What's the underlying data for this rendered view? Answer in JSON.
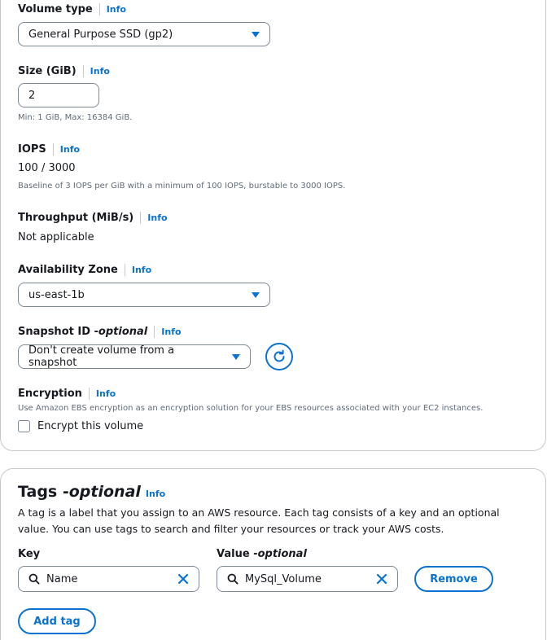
{
  "volume_type": {
    "label": "Volume type",
    "info": "Info",
    "selected": "General Purpose SSD (gp2)"
  },
  "size": {
    "label": "Size (GiB)",
    "info": "Info",
    "value": "2",
    "hint": "Min: 1 GiB, Max: 16384 GiB."
  },
  "iops": {
    "label": "IOPS",
    "info": "Info",
    "value": "100 / 3000",
    "hint": "Baseline of 3 IOPS per GiB with a minimum of 100 IOPS, burstable to 3000 IOPS."
  },
  "throughput": {
    "label": "Throughput (MiB/s)",
    "info": "Info",
    "value": "Not applicable"
  },
  "availability_zone": {
    "label": "Availability Zone",
    "info": "Info",
    "selected": "us-east-1b"
  },
  "snapshot": {
    "label": "Snapshot ID - ",
    "optional": "optional",
    "info": "Info",
    "selected": "Don't create volume from a snapshot"
  },
  "encryption": {
    "label": "Encryption",
    "info": "Info",
    "description": "Use Amazon EBS encryption as an encryption solution for your EBS resources associated with your EC2 instances.",
    "checkbox_label": "Encrypt this volume",
    "checked": false
  },
  "tags": {
    "title": "Tags - ",
    "optional": "optional",
    "info": "Info",
    "description_line1": "A tag is a label that you assign to an AWS resource. Each tag consists of a key and an optional",
    "description_line2": "value. You can use tags to search and filter your resources or track your AWS costs.",
    "key_header": "Key",
    "value_header": "Value - ",
    "value_optional": "optional",
    "rows": [
      {
        "key": "Name",
        "value": "MySql_Volume"
      }
    ],
    "remove_label": "Remove",
    "add_tag_label": "Add tag"
  },
  "colors": {
    "accent": "#0972d3",
    "border": "#7d8998",
    "muted": "#5f6b7a"
  }
}
